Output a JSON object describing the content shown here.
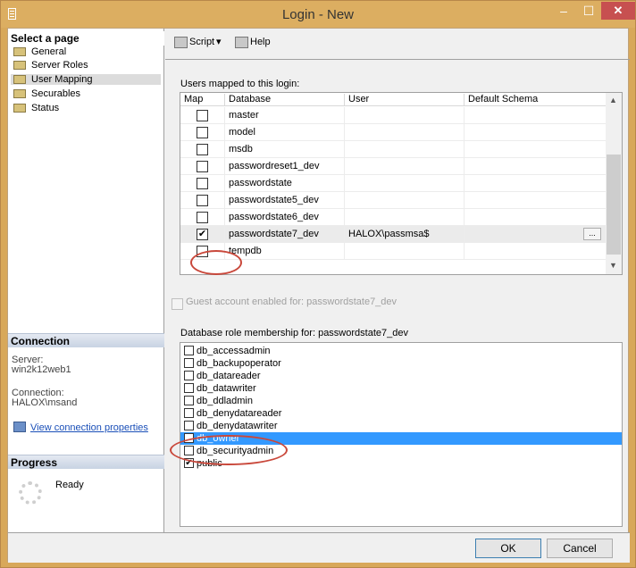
{
  "window": {
    "title": "Login - New",
    "minimize": "–",
    "maximize": "☐",
    "close": "✕"
  },
  "left": {
    "select_heading": "Select a page",
    "pages": [
      {
        "label": "General"
      },
      {
        "label": "Server Roles"
      },
      {
        "label": "User Mapping"
      },
      {
        "label": "Securables"
      },
      {
        "label": "Status"
      }
    ],
    "connection_heading": "Connection",
    "server_label": "Server:",
    "server_value": "win2k12web1",
    "connection_label": "Connection:",
    "connection_value": "HALOX\\msand",
    "view_link": "View connection properties",
    "progress_heading": "Progress",
    "progress_status": "Ready"
  },
  "toolbar": {
    "script_label": "Script",
    "dropdown": "▾",
    "help_label": "Help"
  },
  "users_mapped": {
    "label": "Users mapped to this login:",
    "columns": [
      "Map",
      "Database",
      "User",
      "Default Schema"
    ],
    "rows": [
      {
        "checked": false,
        "database": "master",
        "user": "",
        "schema": ""
      },
      {
        "checked": false,
        "database": "model",
        "user": "",
        "schema": ""
      },
      {
        "checked": false,
        "database": "msdb",
        "user": "",
        "schema": ""
      },
      {
        "checked": false,
        "database": "passwordreset1_dev",
        "user": "",
        "schema": ""
      },
      {
        "checked": false,
        "database": "passwordstate",
        "user": "",
        "schema": ""
      },
      {
        "checked": false,
        "database": "passwordstate5_dev",
        "user": "",
        "schema": ""
      },
      {
        "checked": false,
        "database": "passwordstate6_dev",
        "user": "",
        "schema": ""
      },
      {
        "checked": true,
        "database": "passwordstate7_dev",
        "user": "HALOX\\passmsa$",
        "schema": "",
        "selected": true
      },
      {
        "checked": false,
        "database": "tempdb",
        "user": "",
        "schema": ""
      }
    ],
    "ellipsis": "..."
  },
  "guest": {
    "label": "Guest account enabled for: passwordstate7_dev"
  },
  "role_membership": {
    "label": "Database role membership for: passwordstate7_dev",
    "roles": [
      {
        "name": "db_accessadmin",
        "checked": false
      },
      {
        "name": "db_backupoperator",
        "checked": false
      },
      {
        "name": "db_datareader",
        "checked": false
      },
      {
        "name": "db_datawriter",
        "checked": false
      },
      {
        "name": "db_ddladmin",
        "checked": false
      },
      {
        "name": "db_denydatareader",
        "checked": false
      },
      {
        "name": "db_denydatawriter",
        "checked": false
      },
      {
        "name": "db_owner",
        "checked": true,
        "selected": true
      },
      {
        "name": "db_securityadmin",
        "checked": false
      },
      {
        "name": "public",
        "checked": true
      }
    ]
  },
  "buttons": {
    "ok": "OK",
    "cancel": "Cancel"
  },
  "checkmark": "✔",
  "colors": {
    "selection": "#3399ff",
    "annotation": "#c9483b",
    "frame": "#dcae61"
  }
}
